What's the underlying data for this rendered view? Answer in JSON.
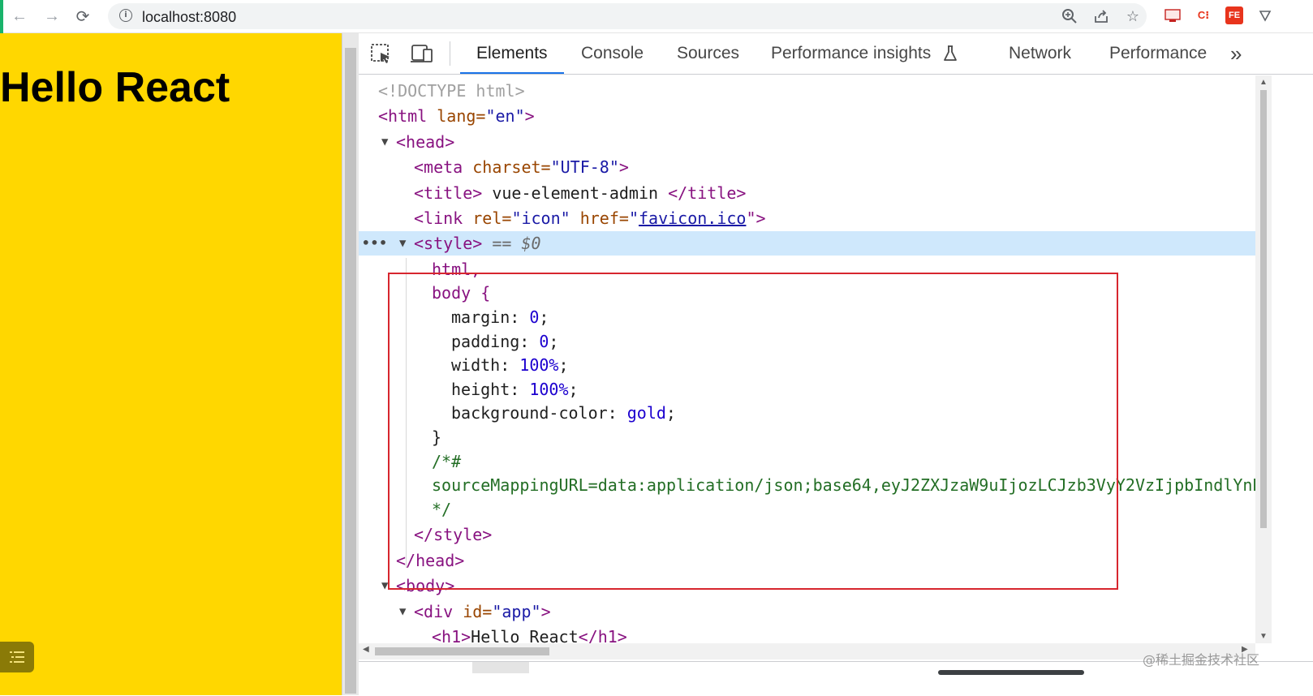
{
  "browser": {
    "url": "localhost:8080",
    "nav": {
      "back": "←",
      "forward": "→",
      "reload": "⟳"
    },
    "extensions": [
      "C⁝",
      "FE"
    ]
  },
  "page": {
    "heading": "Hello React",
    "background_color": "#ffd700"
  },
  "devtools": {
    "tabs": [
      "Elements",
      "Console",
      "Sources",
      "Performance insights",
      "Network",
      "Performance"
    ],
    "active_tab": "Elements",
    "more_tabs": "»",
    "tree": {
      "doctype": "<!DOCTYPE html>",
      "html_open_tag": "<html",
      "html_attr": " lang=",
      "html_val": "\"en\"",
      "html_close": ">",
      "head_open": "<head>",
      "meta_tag": "<meta",
      "meta_attr": " charset=",
      "meta_val": "\"UTF-8\"",
      "meta_close": ">",
      "title_open": "<title>",
      "title_text": " vue-element-admin ",
      "title_close": "</title>",
      "link_tag": "<link",
      "link_attr1": " rel=",
      "link_val1": "\"icon\"",
      "link_attr2": " href=",
      "link_quote": "\"",
      "link_href": "favicon.ico",
      "link_close": "\">",
      "style_open": "<style>",
      "style_eq": " == ",
      "style_dollar": "$0",
      "css_sel1": "html,",
      "css_sel2": "body {",
      "css_margin_prop": "margin: ",
      "css_margin_val": "0",
      "css_padding_prop": "padding: ",
      "css_padding_val": "0",
      "css_width_prop": "width: ",
      "css_width_val": "100%",
      "css_height_prop": "height: ",
      "css_height_val": "100%",
      "css_bg_prop": "background-color: ",
      "css_bg_val": "gold",
      "semicolon": ";",
      "css_brace_close": "}",
      "comment_open": "/*#",
      "comment_body": "sourceMappingURL=data:application/json;base64,eyJ2ZXJzaW9uIjozLCJzb3VyY2VzIjpbIndlYnB",
      "comment_close": "*/",
      "style_close": "</style>",
      "head_close": "</head>",
      "body_open": "<body>",
      "div_tag": "<div",
      "div_attr": " id=",
      "div_val": "\"app\"",
      "div_close": ">",
      "h1_open": "<h1>",
      "h1_text": "Hello React",
      "h1_close": "</h1>",
      "selected_dots": "•••"
    }
  },
  "watermark": "@稀土掘金技术社区"
}
